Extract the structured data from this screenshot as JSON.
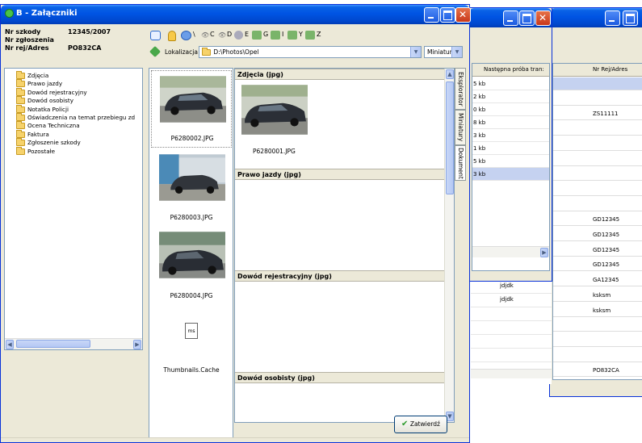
{
  "main_window": {
    "title": "B - Załączniki",
    "info": [
      {
        "label": "Nr szkody",
        "value": "12345/2007"
      },
      {
        "label": "Nr zgłoszenia",
        "value": ""
      },
      {
        "label": "Nr rej/Adres",
        "value": "PO832CA"
      }
    ],
    "toolbar_labels": [
      "\\",
      "C",
      "D",
      "E",
      "G",
      "I",
      "Y",
      "Z"
    ],
    "location_label": "Lokalizacja",
    "location_path": "D:\\Photos\\Opel",
    "view_select": "Miniatury",
    "tree": [
      "Zdjęcia",
      "Prawo jazdy",
      "Dowód rejestracyjny",
      "Dowód osobisty",
      "Notatka Policji",
      "Oświadczenia na temat przebiegu zd",
      "Ocena Techniczna",
      "Faktura",
      "Zgłoszenie szkody",
      "Pozostałe"
    ],
    "thumbnails": [
      "P6280002.JPG",
      "P6280003.JPG",
      "P6280004.JPG",
      "Thumbnails.Cache"
    ],
    "doc_sections": [
      {
        "header": "Zdjęcia (jpg)",
        "file": "P6280001.JPG"
      },
      {
        "header": "Prawo jazdy (jpg)"
      },
      {
        "header": "Dowód rejestracyjny (jpg)"
      },
      {
        "header": "Dowód osobisty (jpg)"
      }
    ],
    "side_tabs": [
      "Eksplorator",
      "Miniatury",
      "Dokument"
    ],
    "confirm_button": "Zatwierdź"
  },
  "window2": {
    "column_header": "Następna próba tran:",
    "rows": [
      "5 kb",
      "2 kb",
      "0 kb",
      "8 kb",
      "3 kb",
      "1 kb",
      "5 kb",
      "3 kb"
    ]
  },
  "window3": {
    "column_header": "Nr Rej/Adres",
    "rows": [
      "",
      "",
      "ZS11111",
      "",
      "",
      "",
      "",
      "",
      "",
      "GD12345",
      "GD12345",
      "GD12345",
      "GD12345",
      "GA12345",
      "ksksm",
      "ksksm",
      "",
      "",
      "",
      "PO832CA"
    ]
  },
  "shared_grid": {
    "rows": [
      "jdjdk",
      "jdjdk"
    ]
  },
  "colors": {
    "title_bar": "#0054e3",
    "window_bg": "#ece9d8",
    "selection": "#c5d2f0"
  }
}
